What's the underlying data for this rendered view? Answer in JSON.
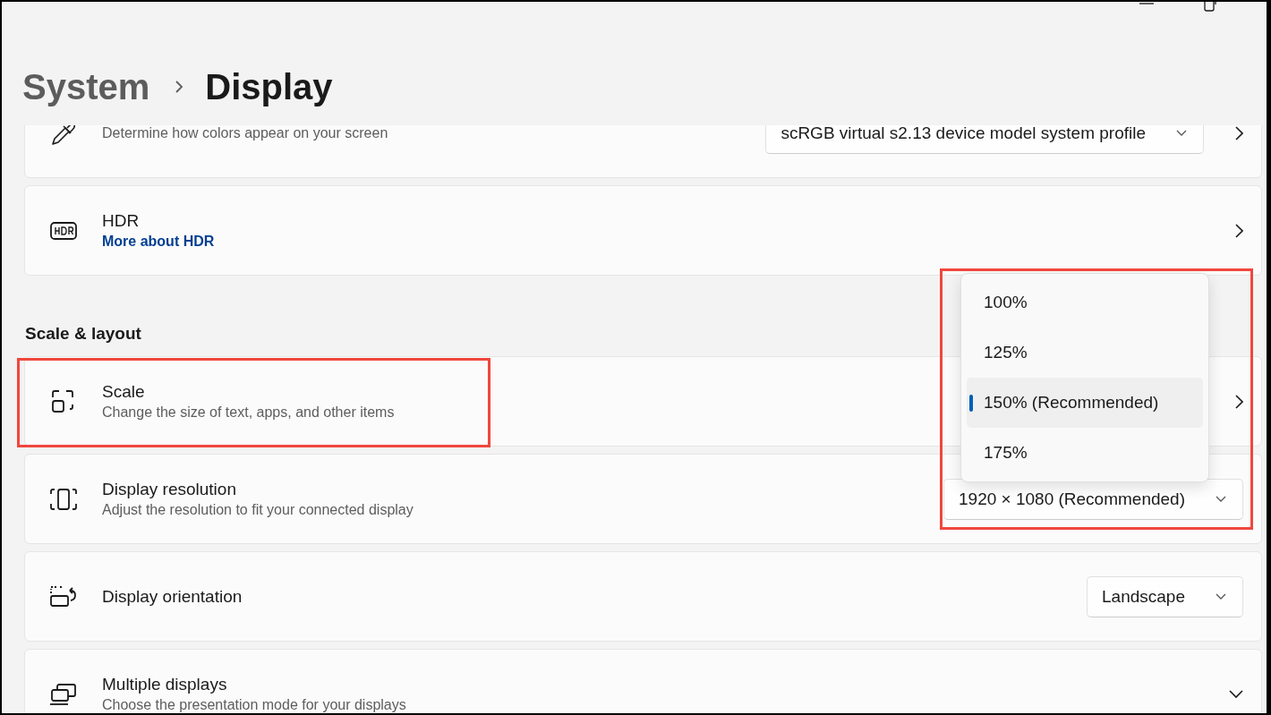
{
  "breadcrumb": {
    "parent": "System",
    "current": "Display"
  },
  "items": [
    {
      "kind": "card",
      "description": "Determine how colors appear on your screen",
      "dropdown": {
        "value": "scRGB virtual s2.13 device model system profile"
      },
      "arrow": true
    },
    {
      "kind": "card",
      "title": "HDR",
      "link": "More about HDR",
      "arrow": true
    },
    {
      "kind": "heading",
      "text": "Scale & layout"
    },
    {
      "kind": "card",
      "title": "Scale",
      "description": "Change the size of text, apps, and other items",
      "arrow": true,
      "highlighted": true
    },
    {
      "kind": "card",
      "title": "Display resolution",
      "description": "Adjust the resolution to fit your connected display",
      "dropdown": {
        "value": "1920 × 1080 (Recommended)"
      }
    },
    {
      "kind": "card",
      "title": "Display orientation",
      "dropdown": {
        "value": "Landscape"
      }
    },
    {
      "kind": "card",
      "title": "Multiple displays",
      "description": "Choose the presentation mode for your displays",
      "expandable": true
    }
  ],
  "scale_menu": {
    "highlighted": true,
    "options": [
      {
        "label": "100%",
        "selected": false
      },
      {
        "label": "125%",
        "selected": false
      },
      {
        "label": "150% (Recommended)",
        "selected": true
      },
      {
        "label": "175%",
        "selected": false
      }
    ]
  }
}
